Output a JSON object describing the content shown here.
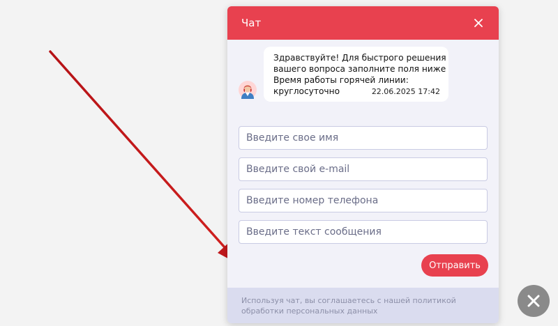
{
  "chat": {
    "title": "Чат",
    "close_icon": "close-icon",
    "message": {
      "lines": [
        "Здравствуйте! Для быстрого решения",
        "вашего вопроса заполните поля ниже",
        "Время работы горячей линии:",
        "круглосуточно"
      ],
      "time": "22.06.2025 17:42",
      "avatar": "operator-avatar"
    },
    "form": {
      "name_placeholder": "Введите свое имя",
      "email_placeholder": "Введите свой e-mail",
      "phone_placeholder": "Введите номер телефона",
      "message_placeholder": "Введите текст сообщения",
      "send_label": "Отправить"
    },
    "footer_text": "Используя чат, вы соглашаетесь с нашей политикой обработки персональных данных"
  },
  "fab": {
    "icon": "close-icon"
  },
  "colors": {
    "accent": "#e8414f",
    "panel_bg": "#f2f2f9",
    "footer_bg": "#dadcef",
    "arrow": "#c0181c",
    "fab_bg": "#8a8a8a"
  }
}
